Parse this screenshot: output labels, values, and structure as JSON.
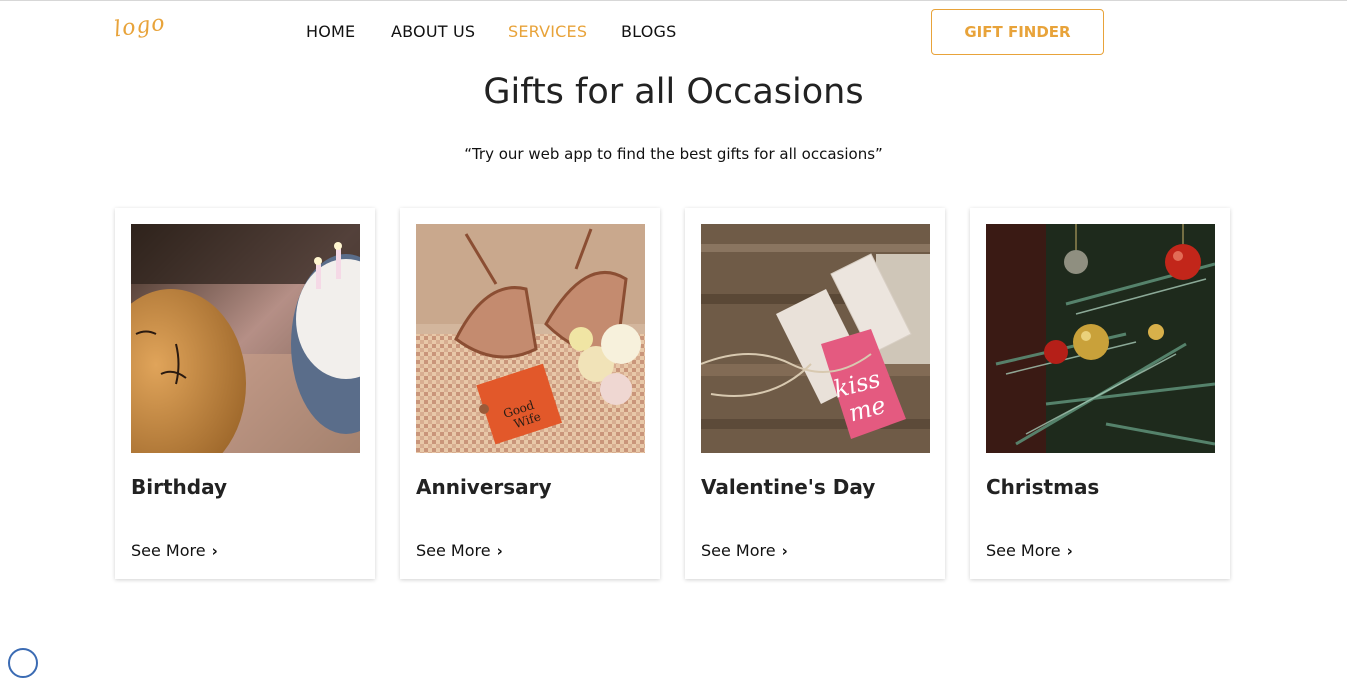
{
  "header": {
    "logo_text": "logo",
    "nav": [
      {
        "label": "HOME",
        "active": false
      },
      {
        "label": "ABOUT US",
        "active": false
      },
      {
        "label": "SERVICES",
        "active": true
      },
      {
        "label": "BLOGS",
        "active": false
      }
    ],
    "cta_label": "GIFT FINDER"
  },
  "hero": {
    "title": "Gifts for all Occasions",
    "subtitle": "“Try our web app to find the best gifts for all occasions”"
  },
  "cards": [
    {
      "name": "Birthday",
      "link": "See More",
      "image": "birthday-cake-balloon-image"
    },
    {
      "name": "Anniversary",
      "link": "See More",
      "image": "heels-and-book-image"
    },
    {
      "name": "Valentine's Day",
      "link": "See More",
      "image": "kiss-me-gift-tags-image"
    },
    {
      "name": "Christmas",
      "link": "See More",
      "image": "christmas-tree-ornaments-image"
    }
  ],
  "colors": {
    "accent": "#e8a33a",
    "text": "#222222"
  }
}
